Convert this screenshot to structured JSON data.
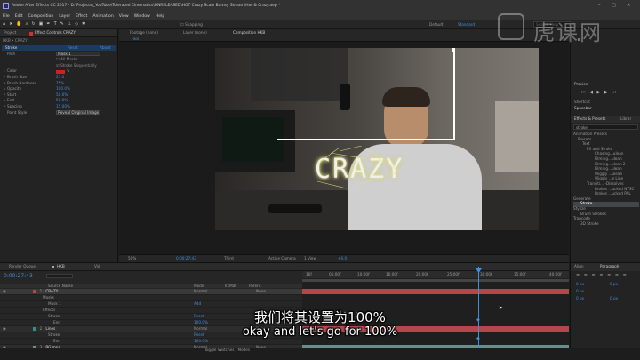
{
  "window": {
    "title": "Adobe After Effects CC 2017 - D:\\Projects\\_YouTube\\Tolerated Cinematics\\UNRELEASED\\HOT Crazy Scale Bamsy Stream\\Hot & Crazy.aep *",
    "controls": [
      "–",
      "□",
      "✕"
    ]
  },
  "menu": [
    "File",
    "Edit",
    "Composition",
    "Layer",
    "Effect",
    "Animation",
    "View",
    "Window",
    "Help"
  ],
  "toolbar": {
    "snapping_label": "Snapping",
    "workspace_default": "Default",
    "workspace_standard": "Standard",
    "search_placeholder": "Search Help"
  },
  "effect_controls": {
    "tabs": [
      "Project",
      "Effect Controls CRAZY"
    ],
    "header": "HKB • CRAZY",
    "effect_name": "Stroke",
    "reset_label": "Reset",
    "about_label": "About",
    "properties": [
      {
        "name": "Path",
        "value": "Mask 1"
      },
      {
        "name": "",
        "value": "All Masks"
      },
      {
        "name": "",
        "value": "Stroke Sequentially"
      },
      {
        "name": "Color",
        "value": ""
      },
      {
        "name": "Brush Size",
        "value": "25.0"
      },
      {
        "name": "Brush Hardness",
        "value": "75%"
      },
      {
        "name": "Opacity",
        "value": "100.0%"
      },
      {
        "name": "Start",
        "value": "50.0%"
      },
      {
        "name": "End",
        "value": "50.0%"
      },
      {
        "name": "Spacing",
        "value": "15.00%"
      },
      {
        "name": "Paint Style",
        "value": "Reveal Original Image"
      }
    ],
    "accent": "#cc2222"
  },
  "composition": {
    "tabs": [
      "Footage (none)",
      "Layer (none)",
      "Composition HKB"
    ],
    "breadcrumb": "HKB",
    "title_text": "CRAZY",
    "viewer_bottom": {
      "zoom": "50%",
      "timecode": "0:00:27:43",
      "resolution": "Third",
      "camera": "Active Camera",
      "view": "1 View",
      "offset": "+0.0"
    }
  },
  "right_panel": {
    "preview_label": "Preview",
    "shortcut_label": "Shortcut",
    "shortcut_value": "Spacebar",
    "effects_label": "Effects & Presets",
    "libraries_label": "Librar",
    "search_value": "stroke",
    "tree": [
      "Animation Presets",
      "Presets",
      "Text",
      "FX and Stroke",
      "Chasing...ulean",
      "Filming...ulean",
      "Filming...ulean 2",
      "Filming...ulean",
      "Wiggly ...ulean",
      "Wiggly ...e Line",
      "Transiti... -Dissolves",
      "Brokes ...ucked NTSC",
      "Brokes ...ucked PAL",
      "Generate",
      "Stroke",
      "Stylize",
      "Brush Strokes",
      "Trapcode",
      "3D Stroke"
    ]
  },
  "timeline": {
    "tabs": [
      "Render Queue",
      "HKB",
      "Vid"
    ],
    "timecode": "0:00:27:43",
    "columns": [
      "Source Name",
      "Mode",
      "TrkMat",
      "Parent"
    ],
    "layers": [
      {
        "num": "1",
        "name": "CRAZY",
        "mode": "Normal",
        "parent": "None"
      },
      {
        "num": "",
        "name": "Masks",
        "mode": "",
        "parent": ""
      },
      {
        "num": "",
        "name": "Mask 1",
        "mode": "Add",
        "parent": ""
      },
      {
        "num": "",
        "name": "Effects",
        "mode": "",
        "parent": ""
      },
      {
        "num": "",
        "name": "Stroke",
        "mode": "Reset",
        "parent": ""
      },
      {
        "num": "",
        "name": "End",
        "mode": "100.0%",
        "parent": ""
      },
      {
        "num": "2",
        "name": "Lines",
        "mode": "Normal",
        "parent": "None"
      },
      {
        "num": "",
        "name": "Stroke",
        "mode": "Reset",
        "parent": ""
      },
      {
        "num": "",
        "name": "End",
        "mode": "100.0%",
        "parent": ""
      },
      {
        "num": "3",
        "name": "BG.mp4",
        "mode": "Normal",
        "parent": "None"
      }
    ],
    "ruler": [
      "16f",
      "06:00f",
      "10:00f",
      "16:00f",
      "20:00f",
      "25:00f",
      "30:00f",
      "35:00f",
      "40:00f"
    ],
    "footer": "Toggle Switches / Modes",
    "layer_colors": [
      "#b5464a",
      "#3d8a8a",
      "#b5464a",
      "#6c8d8d"
    ]
  },
  "paragraph_panel": {
    "tabs": [
      "Align",
      "Paragraph"
    ],
    "values": [
      "0 px",
      "0 px",
      "0 px",
      "0 px",
      "0 px"
    ]
  },
  "subtitles": {
    "zh": "我们将其设置为100%",
    "en": "okay and let's go for 100%"
  },
  "watermark": "虎课网"
}
